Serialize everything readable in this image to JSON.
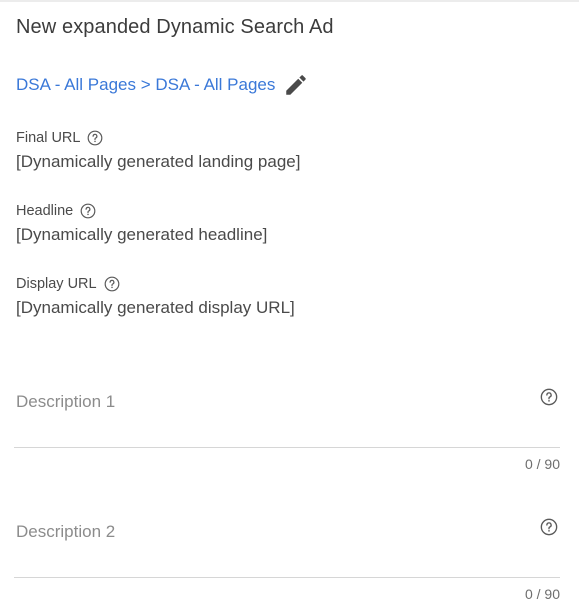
{
  "card": {
    "title": "New expanded Dynamic Search Ad",
    "breadcrumb": "DSA - All Pages > DSA - All Pages"
  },
  "fields": [
    {
      "label": "Final URL",
      "value": "[Dynamically generated landing page]"
    },
    {
      "label": "Headline",
      "value": "[Dynamically generated headline]"
    },
    {
      "label": "Display URL",
      "value": "[Dynamically generated display URL]"
    }
  ],
  "inputs": [
    {
      "placeholder": "Description 1",
      "counter": "0 / 90"
    },
    {
      "placeholder": "Description 2",
      "counter": "0 / 90"
    }
  ],
  "icons": {
    "edit": "pencil-icon",
    "help": "help-circle-icon"
  },
  "colors": {
    "link": "#3a78d8",
    "text": "#424242",
    "placeholder": "#8c8c8c",
    "underline": "#d6d6d6"
  }
}
